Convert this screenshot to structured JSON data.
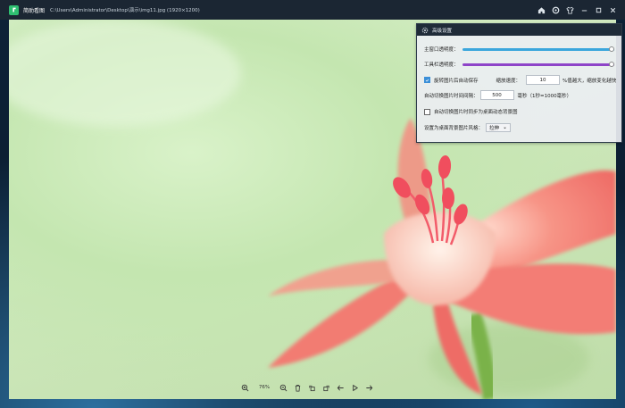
{
  "window": {
    "app_name": "简助看图",
    "file_path": "C:\\Users\\Administrator\\Desktop\\演示\\img11.jpg  (1920×1200)"
  },
  "toolbar": {
    "zoom": "76%"
  },
  "settings": {
    "title": "高级设置",
    "main_opacity_label": "主窗口透明度：",
    "main_opacity_value": 1.0,
    "toolbar_opacity_label": "工具栏透明度：",
    "toolbar_opacity_value": 1.0,
    "autosave_label": "旋转图片后自动保存",
    "autosave_checked": true,
    "zoom_speed_label": "缩放速度：",
    "zoom_speed_value": "10",
    "zoom_speed_hint": "%值越大，缩放变化越快",
    "interval_label": "自动切换图片时间间隔：",
    "interval_value": "500",
    "interval_hint": "毫秒（1秒=1000毫秒）",
    "sync_wallpaper_label": "自动切换图片时同步为桌面动态背景图",
    "sync_wallpaper_checked": false,
    "wallpaper_mode_label": "设置为桌面背景图片风格：",
    "wallpaper_mode_value": "拉伸"
  },
  "colors": {
    "titlebar": "#1b2633",
    "slider_main": "#3ba6dc",
    "slider_toolbar": "#8e44c8",
    "checkbox_on": "#3b8fd8"
  }
}
